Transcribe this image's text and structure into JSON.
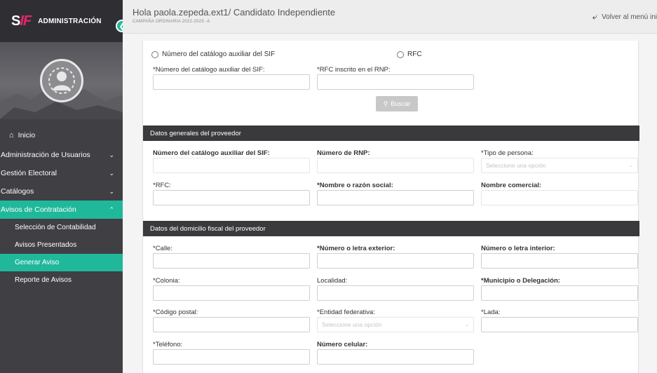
{
  "sidebar": {
    "brand_logo": "SIF",
    "brand_label": "ADMINISTRACIÓN",
    "collapse_icon": "chevron-left-icon",
    "items": [
      {
        "label": "Inicio",
        "icon": "home-icon",
        "expandable": false
      },
      {
        "label": "Administración de Usuarios",
        "expandable": true
      },
      {
        "label": "Gestión Electoral",
        "expandable": true
      },
      {
        "label": "Catálogos",
        "expandable": true
      },
      {
        "label": "Avisos de Contratación",
        "expandable": true,
        "active": true
      }
    ],
    "sub_items": [
      {
        "label": "Selección de Contabilidad"
      },
      {
        "label": "Avisos Presentados"
      },
      {
        "label": "Generar Aviso",
        "active": true
      },
      {
        "label": "Reporte de Avisos"
      }
    ],
    "accent_color": "#20b89a"
  },
  "header": {
    "greeting": "Hola paola.zepeda.ext1/ Candidato Independiente",
    "campaign": "CAMPAÑA ORDINARIA 2022-2023 -A",
    "back_link": "Volver al menú ini"
  },
  "search": {
    "radio_catalog": "Número del catálogo auxiliar del SIF",
    "radio_rfc": "RFC",
    "catalog_label": "*Número del catálogo auxiliar del SIF:",
    "rfc_rnp_label": "*RFC inscrito en el RNP:",
    "button": "Buscar"
  },
  "general": {
    "title": "Datos generales del proveedor",
    "catalog_label": "Número del catálogo auxiliar del SIF:",
    "rnp_label": "Número de RNP:",
    "person_type_label": "*Tipo de persona:",
    "person_type_placeholder": "Seleccione una opción",
    "rfc_label": "*RFC:",
    "name_label": "*Nombre o razón social:",
    "commercial_label": "Nombre comercial:"
  },
  "address": {
    "title": "Datos del domicilio fiscal del proveedor",
    "street_label": "*Calle:",
    "ext_number_label": "*Número o letra exterior:",
    "int_number_label": "Número o letra interior:",
    "colonia_label": "*Colonia:",
    "localidad_label": "Localidad:",
    "municipio_label": "*Municipio o Delegación:",
    "postal_label": "*Código postal:",
    "state_label": "*Entidad federativa:",
    "state_placeholder": "Seleccione una opción",
    "lada_label": "*Lada:",
    "phone_label": "*Teléfono:",
    "mobile_label": "Número celular:"
  }
}
